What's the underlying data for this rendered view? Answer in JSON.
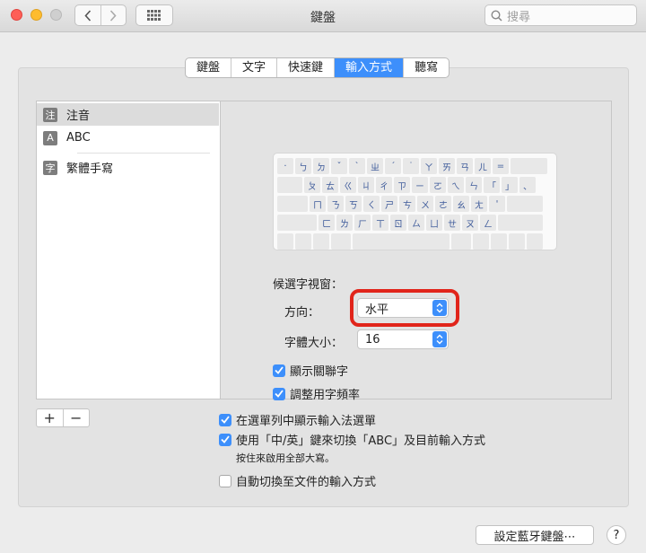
{
  "window": {
    "title": "鍵盤"
  },
  "search": {
    "placeholder": "搜尋"
  },
  "tabs": [
    {
      "label": "鍵盤"
    },
    {
      "label": "文字"
    },
    {
      "label": "快速鍵"
    },
    {
      "label": "輸入方式"
    },
    {
      "label": "聽寫"
    }
  ],
  "sources": [
    {
      "badge": "注",
      "label": "注音"
    },
    {
      "badge": "A",
      "label": "ABC"
    },
    {
      "badge": "字",
      "label": "繁體手寫"
    }
  ],
  "keyboard_rows": [
    [
      "·",
      "ㄅ",
      "ㄉ",
      "ˇ",
      "ˋ",
      "ㄓ",
      "ˊ",
      "˙",
      "ㄚ",
      "ㄞ",
      "ㄢ",
      "ㄦ",
      "="
    ],
    [
      "ㄆ",
      "ㄊ",
      "ㄍ",
      "ㄐ",
      "ㄔ",
      "ㄗ",
      "ㄧ",
      "ㄛ",
      "ㄟ",
      "ㄣ",
      "「",
      "」",
      "、"
    ],
    [
      "ㄇ",
      "ㄋ",
      "ㄎ",
      "ㄑ",
      "ㄕ",
      "ㄘ",
      "ㄨ",
      "ㄜ",
      "ㄠ",
      "ㄤ",
      "'"
    ],
    [
      "ㄈ",
      "ㄌ",
      "ㄏ",
      "ㄒ",
      "ㄖ",
      "ㄙ",
      "ㄩ",
      "ㄝ",
      "ㄡ",
      "ㄥ"
    ]
  ],
  "candidate": {
    "section_label": "候選字視窗：",
    "direction_label": "方向：",
    "direction_value": "水平",
    "fontsize_label": "字體大小：",
    "fontsize_value": "16"
  },
  "options": {
    "show_assoc": "顯示關聯字",
    "adjust_freq": "調整用字頻率"
  },
  "list_controls": {
    "add": "+",
    "remove": "−"
  },
  "bottom": {
    "show_menu": "在選單列中顯示輸入法選單",
    "switch_abc": "使用「中/英」鍵來切換「ABC」及目前輸入方式",
    "hint": "按住來啟用全部大寫。",
    "auto_switch": "自動切換至文件的輸入方式"
  },
  "footer": {
    "bluetooth_button": "設定藍牙鍵盤⋯",
    "help": "?"
  },
  "colors": {
    "accent": "#3d8ffb",
    "highlight": "#e1251b"
  }
}
